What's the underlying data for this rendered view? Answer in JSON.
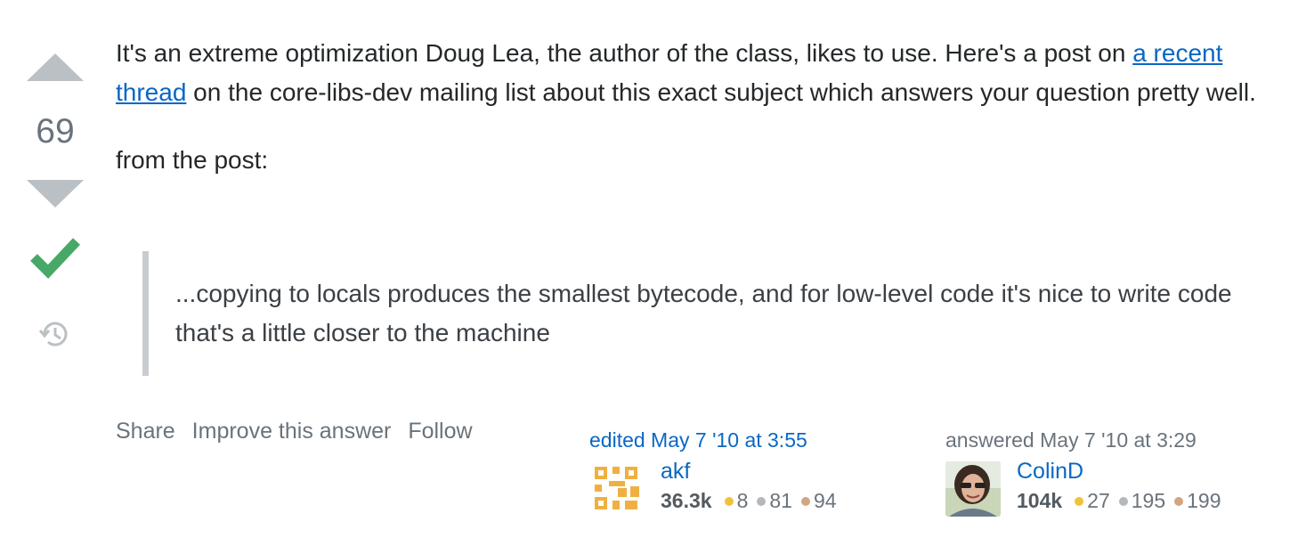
{
  "vote": {
    "count": "69",
    "upvote_label": "Upvote",
    "downvote_label": "Downvote"
  },
  "post": {
    "p1_before": "It's an extreme optimization Doug Lea, the author of the class, likes to use. Here's a post on ",
    "link_text": "a recent thread",
    "p1_after": " on the core-libs-dev mailing list about this exact subject which answers your question pretty well.",
    "p2": "from the post:",
    "quote": "...copying to locals produces the smallest bytecode, and for low-level code it's nice to write code that's a little closer to the machine"
  },
  "menu": {
    "share": "Share",
    "improve": "Improve this answer",
    "follow": "Follow"
  },
  "editor": {
    "action": "edited May 7 '10 at 3:55",
    "name": "akf",
    "reputation": "36.3k",
    "gold": "8",
    "silver": "81",
    "bronze": "94"
  },
  "answerer": {
    "action": "answered May 7 '10 at 3:29",
    "name": "ColinD",
    "reputation": "104k",
    "gold": "27",
    "silver": "195",
    "bronze": "199"
  },
  "colors": {
    "link": "#0a67c4",
    "accepted": "#48a868",
    "gold": "#f0c23c",
    "silver": "#b4b8bc",
    "bronze": "#d1a684",
    "vote_arrow": "#bbc0c4"
  }
}
